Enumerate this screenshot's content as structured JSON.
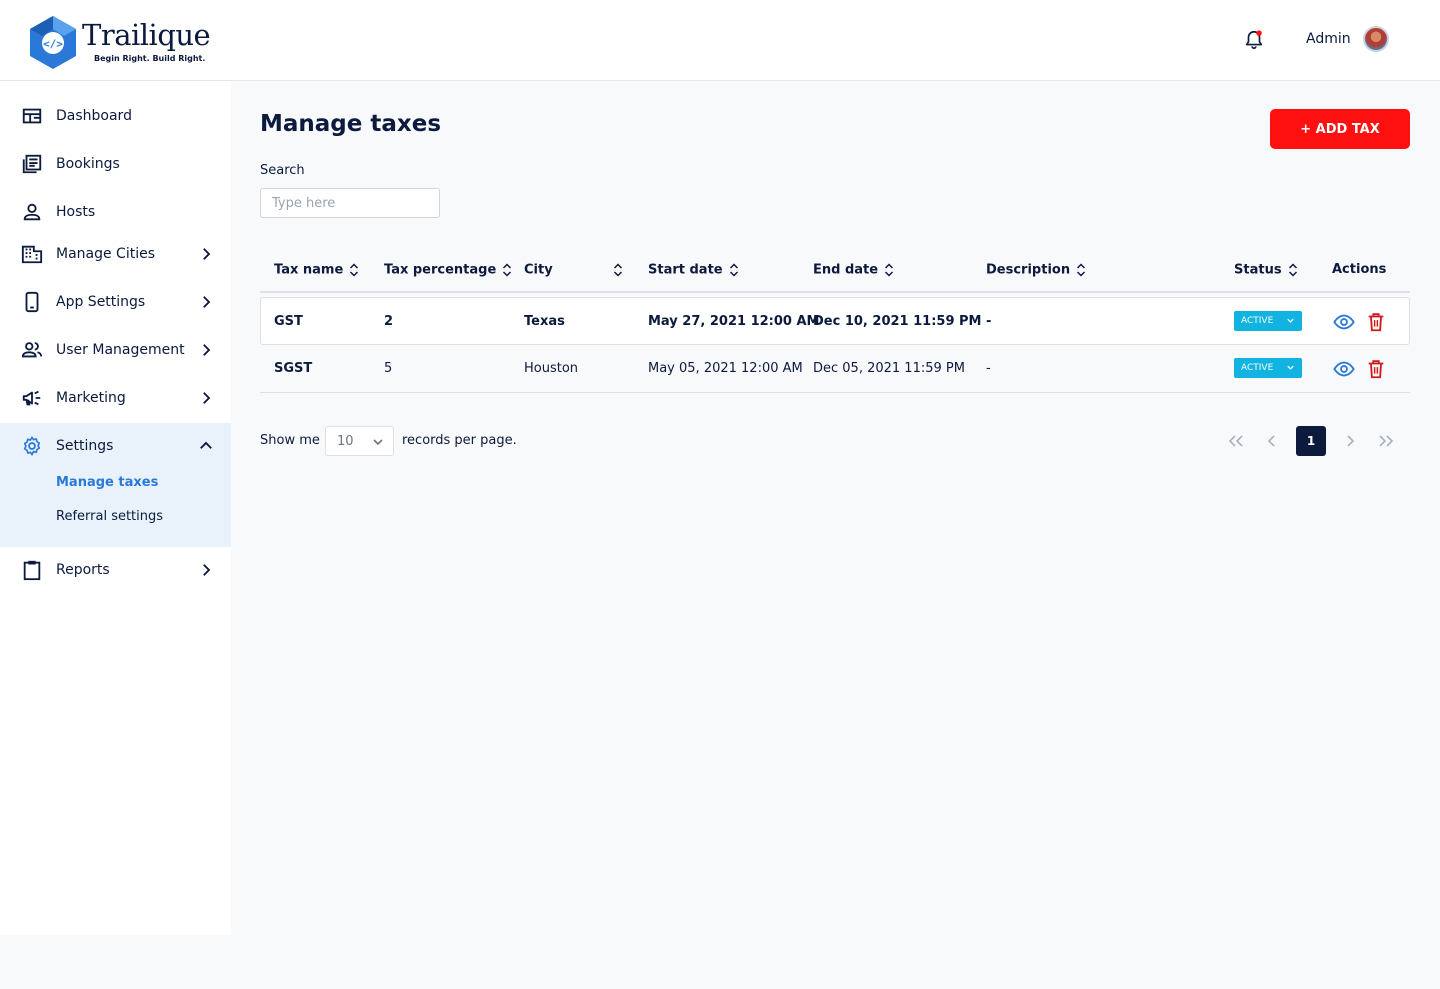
{
  "brand": {
    "name": "Trailique",
    "tagline": "Begin Right. Build Right.",
    "primary_color": "#0c1a3d",
    "accent_color": "#ff1010",
    "logo_icon": "code-hexagon-icon"
  },
  "header": {
    "user_name": "Admin",
    "notification_icon": "bell-icon",
    "has_unread_notifications": true
  },
  "sidebar": {
    "items": [
      {
        "label": "Dashboard",
        "icon": "dashboard-icon",
        "has_chevron": false
      },
      {
        "label": "Bookings",
        "icon": "bookings-icon",
        "has_chevron": false
      },
      {
        "label": "Hosts",
        "icon": "person-icon",
        "has_chevron": false
      },
      {
        "label": "Manage Cities",
        "icon": "building-icon",
        "has_chevron": true
      },
      {
        "label": "App Settings",
        "icon": "phone-icon",
        "has_chevron": true
      },
      {
        "label": "User Management",
        "icon": "users-icon",
        "has_chevron": true
      },
      {
        "label": "Marketing",
        "icon": "megaphone-icon",
        "has_chevron": true
      },
      {
        "label": "Settings",
        "icon": "gear-icon",
        "has_chevron": true,
        "expanded": true
      },
      {
        "label": "Reports",
        "icon": "clipboard-icon",
        "has_chevron": true
      }
    ],
    "settings_subitems": [
      {
        "label": "Manage taxes",
        "active": true
      },
      {
        "label": "Referral settings",
        "active": false
      }
    ]
  },
  "page": {
    "title": "Manage taxes",
    "add_button_label": "+ ADD TAX",
    "search_label": "Search",
    "search_placeholder": "Type here",
    "search_value": ""
  },
  "table": {
    "columns": [
      "Tax name",
      "Tax percentage",
      "City",
      "Start date",
      "End date",
      "Description",
      "Status",
      "Actions"
    ],
    "rows": [
      {
        "tax_name": "GST",
        "tax_percentage": "2",
        "city": "Texas",
        "start_date": "May 27, 2021 12:00 AM",
        "end_date": "Dec 10, 2021 11:59 PM",
        "description": "-",
        "status": "ACTIVE"
      },
      {
        "tax_name": "SGST",
        "tax_percentage": "5",
        "city": "Houston",
        "start_date": "May 05, 2021 12:00 AM",
        "end_date": "Dec 05, 2021  11:59 PM",
        "description": "-",
        "status": "ACTIVE"
      }
    ],
    "status_color": "#11b3e0",
    "view_icon": "eye-icon",
    "delete_icon": "trash-icon"
  },
  "pagination": {
    "show_label": "Show me",
    "per_page_value": "10",
    "records_label": "records per page.",
    "current_page": "1"
  }
}
